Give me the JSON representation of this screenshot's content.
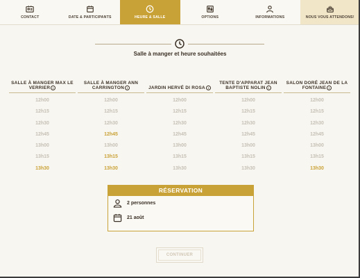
{
  "nav": {
    "tabs": [
      {
        "label": "CONTACT",
        "icon": "id-card-icon"
      },
      {
        "label": "DATE & PARTICIPANTS",
        "icon": "calendar-icon"
      },
      {
        "label": "HEURE & SALLE",
        "icon": "clock-icon",
        "active": true
      },
      {
        "label": "OPTIONS",
        "icon": "options-icon"
      },
      {
        "label": "INFORMATIONS",
        "icon": "user-icon"
      },
      {
        "label": "NOUS VOUS ATTENDONS!",
        "icon": "cake-icon"
      }
    ]
  },
  "section": {
    "title": "Salle à manger et heure souhaitées"
  },
  "colors": {
    "accent": "#c9a237",
    "slot_disabled": "#c5c0b6",
    "background": "#f8f6f0"
  },
  "rooms": [
    {
      "name": "SALLE À MANGER MAX LE VERRIER",
      "slots": [
        "12h00",
        "12h15",
        "12h30",
        "12h45",
        "13h00",
        "13h15",
        "13h30"
      ],
      "available": [
        false,
        false,
        false,
        false,
        false,
        false,
        true
      ]
    },
    {
      "name": "SALLE À MANGER ANN CARRINGTON",
      "slots": [
        "12h00",
        "12h15",
        "12h30",
        "12h45",
        "13h00",
        "13h15",
        "13h30"
      ],
      "available": [
        false,
        false,
        false,
        true,
        false,
        true,
        true
      ]
    },
    {
      "name": "JARDIN HERVÉ DI ROSA",
      "slots": [
        "12h00",
        "12h15",
        "12h30",
        "12h45",
        "13h00",
        "13h15",
        "13h30"
      ],
      "available": [
        false,
        false,
        false,
        false,
        false,
        false,
        false
      ]
    },
    {
      "name": "TENTE D'APPARAT JEAN BAPTISTE NOLIN",
      "slots": [
        "12h00",
        "12h15",
        "12h30",
        "12h45",
        "13h00",
        "13h15",
        "13h30"
      ],
      "available": [
        false,
        false,
        false,
        false,
        false,
        false,
        false
      ]
    },
    {
      "name": "SALON DORÉ JEAN DE LA FONTAINE",
      "slots": [
        "12h00",
        "12h15",
        "12h30",
        "12h45",
        "13h00",
        "13h15",
        "13h30"
      ],
      "available": [
        false,
        false,
        false,
        false,
        false,
        false,
        true
      ]
    }
  ],
  "reservation": {
    "title": "RÉSERVATION",
    "persons": "2 personnes",
    "date": "21 août"
  },
  "continue_label": "CONTINUER"
}
